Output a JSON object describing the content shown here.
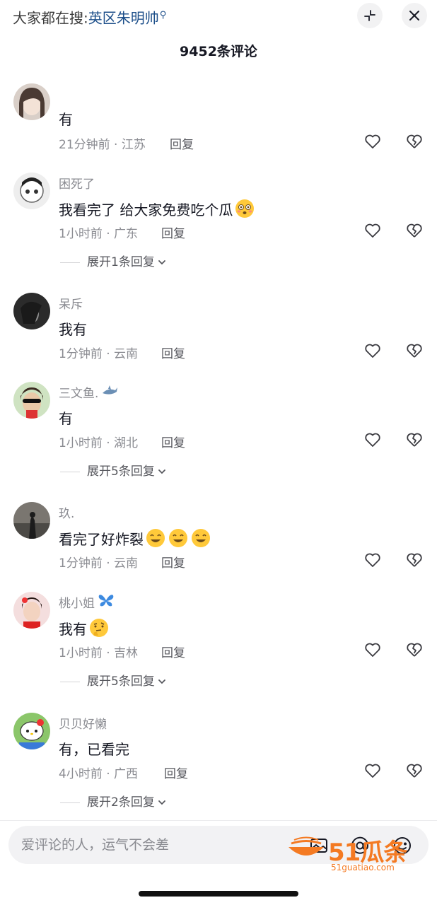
{
  "header": {
    "search_prefix": "大家都在搜:",
    "search_keyword": "英区朱明帅",
    "comment_count": "9452条评论"
  },
  "icons": {
    "collapse": "collapse-arrows-icon",
    "close": "close-icon",
    "like": "heart-outline-icon",
    "dislike": "broken-heart-icon",
    "expand": "chevron-down-icon",
    "image": "image-icon",
    "mention": "at-sign-icon",
    "emoji": "emoji-face-icon"
  },
  "comments": [
    {
      "username": "",
      "text": "有",
      "time_location": "21分钟前 · 江苏",
      "reply_label": "回复",
      "expand_label": ""
    },
    {
      "username": "困死了",
      "text": "我看完了 给大家免费吃个瓜",
      "emoji": "flushed-face-emoji",
      "time_location": "1小时前 · 广东",
      "reply_label": "回复",
      "expand_label": "展开1条回复"
    },
    {
      "username": "呆斥",
      "text": "我有",
      "time_location": "1分钟前 · 云南",
      "reply_label": "回复",
      "expand_label": ""
    },
    {
      "username": "三文鱼.",
      "username_emoji": "shark-emoji",
      "text": "有",
      "time_location": "1小时前 · 湖北",
      "reply_label": "回复",
      "expand_label": "展开5条回复"
    },
    {
      "username": "玖.",
      "text": "看完了好炸裂",
      "emoji": "grinning-face-emoji",
      "time_location": "1分钟前 · 云南",
      "reply_label": "回复",
      "expand_label": ""
    },
    {
      "username": "桃小姐",
      "username_emoji": "butterfly-emoji",
      "text": "我有",
      "emoji": "thinking-face-emoji",
      "time_location": "1小时前 · 吉林",
      "reply_label": "回复",
      "expand_label": "展开5条回复"
    },
    {
      "username": "贝贝好懒",
      "text": "有，已看完",
      "time_location": "4小时前 · 广西",
      "reply_label": "回复",
      "expand_label": "展开2条回复"
    }
  ],
  "input": {
    "placeholder": "爱评论的人，运气不会差"
  },
  "watermark": {
    "main": "51瓜条",
    "sub": "51guatiao.com"
  },
  "colors": {
    "accent_keyword": "#1d4f8a",
    "secondary_text": "#8a8b91",
    "watermark": "#f47a22"
  }
}
